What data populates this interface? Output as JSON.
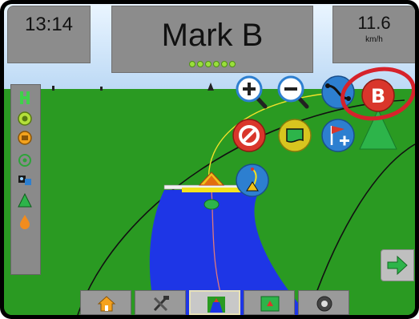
{
  "status_bar": {
    "time": "13:14",
    "title": "Mark B",
    "speed_value": "11.6",
    "speed_unit": "km/h",
    "gps_signal_dots": 6
  },
  "left_panel": {
    "icons": [
      "boom-status-icon",
      "section-control-icon",
      "rate-control-icon",
      "boom-height-icon",
      "gps-receiver-icon",
      "guidance-triangle-icon",
      "droplet-icon"
    ]
  },
  "map_buttons": [
    {
      "name": "zoom-in-button",
      "icon": "magnifier-plus-icon",
      "color": "#2d7fd0"
    },
    {
      "name": "zoom-out-button",
      "icon": "magnifier-minus-icon",
      "color": "#2d7fd0"
    },
    {
      "name": "guideline-button",
      "icon": "guideline-icon",
      "color": "#2d7fd0"
    },
    {
      "name": "mark-b-button",
      "label": "B",
      "color": "#d9362b"
    },
    {
      "name": "cancel-button",
      "icon": "no-entry-icon",
      "color": "#d9362b"
    },
    {
      "name": "boundary-button",
      "icon": "boundary-icon",
      "color": "#d8c51f"
    },
    {
      "name": "add-marker-button",
      "icon": "flag-plus-icon",
      "color": "#2d7fd0"
    },
    {
      "name": "curve-steer-button",
      "icon": "curve-icon",
      "color": "#2d7fd0"
    }
  ],
  "bottom_tabs": [
    {
      "name": "home",
      "icon": "home-icon"
    },
    {
      "name": "tools",
      "icon": "wrench-hammer-icon"
    },
    {
      "name": "vehicle-view",
      "icon": "vehicle-view-icon",
      "active": true
    },
    {
      "name": "field-view",
      "icon": "field-view-icon"
    },
    {
      "name": "rear-view",
      "icon": "camera-icon"
    }
  ],
  "colors": {
    "sky": "#cfe8ff",
    "field": "#2a9a22",
    "coverage": "#1e36e6",
    "highlight": "#d6222b"
  }
}
